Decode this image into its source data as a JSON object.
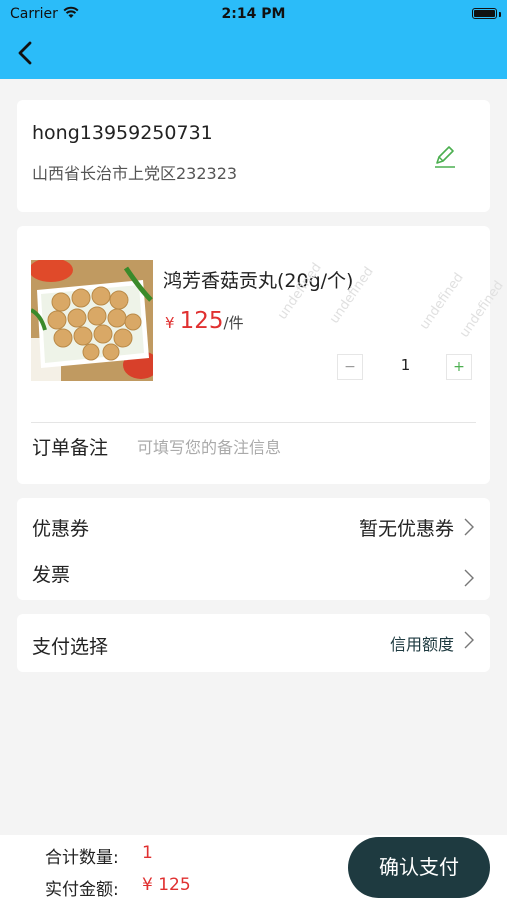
{
  "status_bar": {
    "carrier": "Carrier",
    "time": "2:14 PM"
  },
  "address": {
    "name_phone": "hong13959250731",
    "detail": "山西省长治市上党区232323"
  },
  "product": {
    "name": "鸿芳香菇贡丸(20g/个)",
    "currency_symbol": "¥",
    "price": "125",
    "unit": "/件",
    "quantity": "1",
    "minus_label": "−",
    "plus_label": "+",
    "watermark_text": "undefined"
  },
  "remark": {
    "label": "订单备注",
    "placeholder": "可填写您的备注信息"
  },
  "coupon": {
    "label": "优惠券",
    "value": "暂无优惠券"
  },
  "invoice": {
    "label": "发票"
  },
  "payment": {
    "label": "支付选择",
    "value": "信用额度"
  },
  "footer": {
    "total_count_label": "合计数量:",
    "total_count": "1",
    "amount_label": "实付金额:",
    "amount": "¥ 125",
    "confirm_label": "确认支付"
  },
  "colors": {
    "header": "#2bbcf9",
    "price": "#e03030",
    "button": "#1e3a40",
    "edit_icon": "#4caf50"
  }
}
